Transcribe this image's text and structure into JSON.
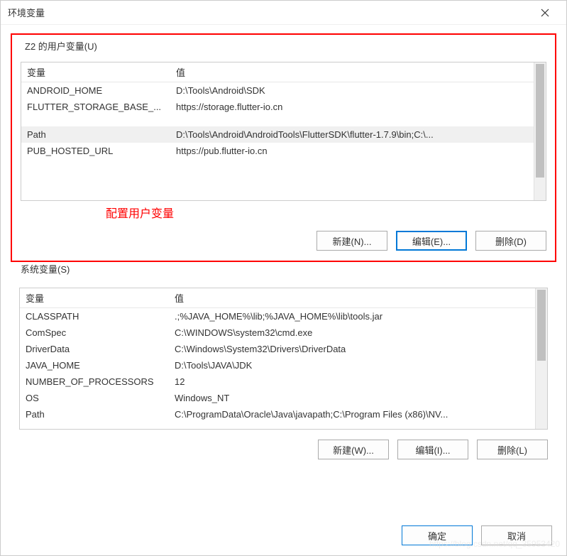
{
  "window": {
    "title": "环境变量"
  },
  "userVars": {
    "groupLabel": "Z2 的用户变量(U)",
    "annotation": "配置用户变量",
    "headers": {
      "variable": "变量",
      "value": "值"
    },
    "rows": [
      {
        "variable": "ANDROID_HOME",
        "value": "D:\\Tools\\Android\\SDK",
        "selected": false
      },
      {
        "variable": "FLUTTER_STORAGE_BASE_...",
        "value": "https://storage.flutter-io.cn",
        "selected": false
      },
      {
        "variable": "",
        "value": "",
        "selected": false
      },
      {
        "variable": "",
        "value": "",
        "selected": false
      },
      {
        "variable": "Path",
        "value": "D:\\Tools\\Android\\AndroidTools\\FlutterSDK\\flutter-1.7.9\\bin;C:\\...",
        "selected": true
      },
      {
        "variable": "PUB_HOSTED_URL",
        "value": "https://pub.flutter-io.cn",
        "selected": false
      }
    ],
    "buttons": {
      "new": "新建(N)...",
      "edit": "编辑(E)...",
      "delete": "删除(D)"
    }
  },
  "sysVars": {
    "groupLabel": "系统变量(S)",
    "headers": {
      "variable": "变量",
      "value": "值"
    },
    "rows": [
      {
        "variable": "CLASSPATH",
        "value": ".;%JAVA_HOME%\\lib;%JAVA_HOME%\\lib\\tools.jar"
      },
      {
        "variable": "ComSpec",
        "value": "C:\\WINDOWS\\system32\\cmd.exe"
      },
      {
        "variable": "DriverData",
        "value": "C:\\Windows\\System32\\Drivers\\DriverData"
      },
      {
        "variable": "JAVA_HOME",
        "value": "D:\\Tools\\JAVA\\JDK"
      },
      {
        "variable": "NUMBER_OF_PROCESSORS",
        "value": "12"
      },
      {
        "variable": "OS",
        "value": "Windows_NT"
      },
      {
        "variable": "Path",
        "value": "C:\\ProgramData\\Oracle\\Java\\javapath;C:\\Program Files (x86)\\NV..."
      }
    ],
    "buttons": {
      "new": "新建(W)...",
      "edit": "编辑(I)...",
      "delete": "删除(L)"
    }
  },
  "dialog": {
    "ok": "确定",
    "cancel": "取消"
  },
  "watermark": "https://blog.csdn.net/qq_35953420"
}
